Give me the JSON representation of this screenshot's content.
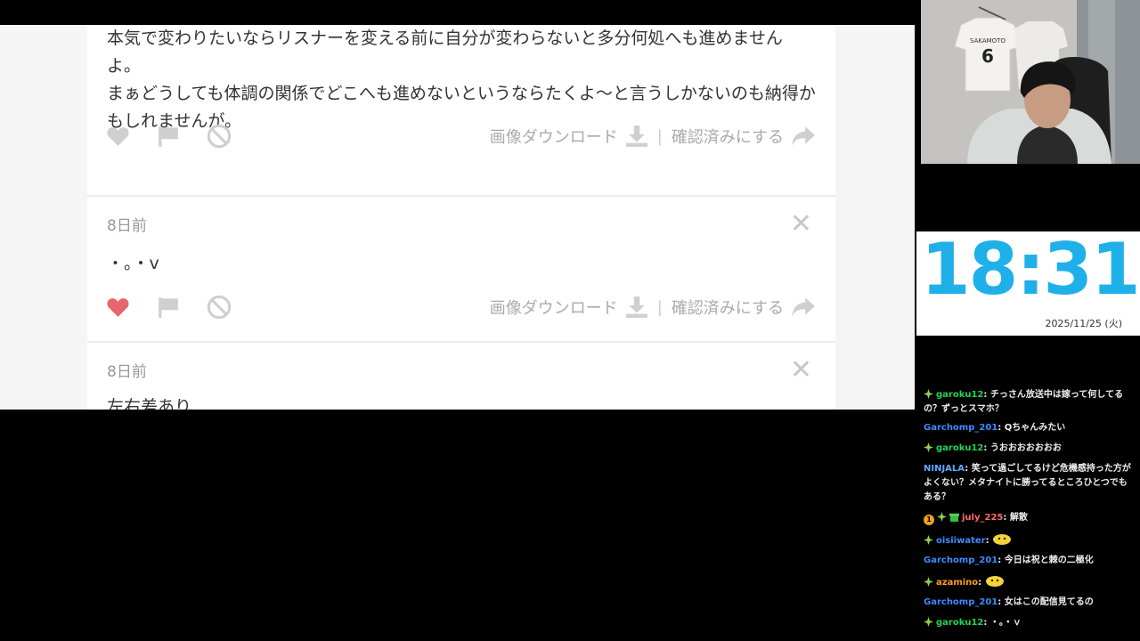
{
  "page": {
    "entries": [
      {
        "body": "本気で変わりたいならリスナーを変える前に自分が変わらないと多分何処へも進めませんよ。\nまぁどうしても体調の関係でどこへも進めないというならたくよ～と言うしかないのも納得かもしれませんが。"
      },
      {
        "age": "8日前",
        "body": "・。・v",
        "liked": true
      },
      {
        "age": "8日前",
        "body": "左右差あり\n【S】"
      }
    ],
    "actions": {
      "download_label": "画像ダウンロード",
      "confirm_label": "確認済みにする",
      "separator": "|"
    },
    "close_symbol": "✕"
  },
  "clock": {
    "time": "18:31",
    "date": "2025/11/25 (火)"
  },
  "webcam": {
    "jersey_name": "SAKAMOTO",
    "jersey_number": "6"
  },
  "chat": {
    "messages": [
      {
        "user": "garoku12",
        "text": "チっさん放送中は嫁って何してるの？ずっとスマホ？",
        "color": "#1fd655"
      },
      {
        "user": "Garchomp_201",
        "text": "Qちゃんみたい",
        "color": "#3e8bff"
      },
      {
        "user": "garoku12",
        "text": "うおおおおおおお",
        "color": "#1fd655"
      },
      {
        "user": "NINJALA",
        "text": "笑って過ごしてるけど危機感持った方がよくない？メタナイトに勝ってるところひとつでもある？",
        "color": "#62a8ff"
      },
      {
        "user": "july_225",
        "text": "解散",
        "color": "#ff6b6b",
        "badge": "1"
      },
      {
        "user": "oisiiwater",
        "text": "",
        "color": "#3e8bff"
      },
      {
        "user": "Garchomp_201",
        "text": "今日は祝と棘の二極化",
        "color": "#3e8bff"
      },
      {
        "user": "azamino",
        "text": "",
        "color": "#ff9d1f"
      },
      {
        "user": "Garchomp_201",
        "text": "女はこの配信見てるの",
        "color": "#3e8bff"
      },
      {
        "user": "garoku12",
        "text": "・。・ｖ",
        "color": "#1fd655"
      }
    ]
  },
  "colors": {
    "accent": "#1fb0ea",
    "like_active": "#e8646f",
    "icon_gray": "#c8c8c8",
    "text_gray": "#aaaaaa"
  },
  "icons": [
    "heart-icon",
    "flag-icon",
    "block-icon",
    "download-icon",
    "share-arrow-icon",
    "close-icon",
    "sparkle-badge-icon",
    "sub-badge-icon"
  ]
}
